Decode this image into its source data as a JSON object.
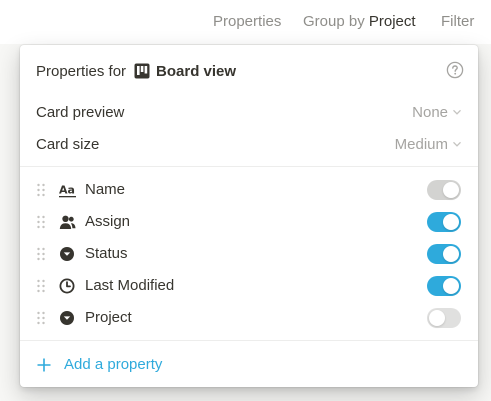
{
  "toolbar": {
    "properties_label": "Properties",
    "group_by_prefix": "Group by",
    "group_by_value": "Project",
    "filter_label": "Filter"
  },
  "popup": {
    "header_prefix": "Properties for",
    "view_name": "Board view",
    "view_icon": "board-icon",
    "help_icon": "question-circle-icon",
    "settings": [
      {
        "label": "Card preview",
        "value": "None"
      },
      {
        "label": "Card size",
        "value": "Medium"
      }
    ],
    "properties": [
      {
        "name": "Name",
        "icon": "text-aa-icon",
        "visible": true,
        "locked": true
      },
      {
        "name": "Assign",
        "icon": "person-icon",
        "visible": true,
        "locked": false
      },
      {
        "name": "Status",
        "icon": "select-icon",
        "visible": true,
        "locked": false
      },
      {
        "name": "Last Modified",
        "icon": "clock-icon",
        "visible": true,
        "locked": false
      },
      {
        "name": "Project",
        "icon": "select-icon",
        "visible": false,
        "locked": false
      }
    ],
    "add_property_label": "Add a property"
  },
  "colors": {
    "accent": "#2eaadc",
    "text": "#37352f",
    "muted": "#8f8e8a",
    "toggle_off": "#e0e0df",
    "toggle_locked": "#d3d3d1"
  }
}
